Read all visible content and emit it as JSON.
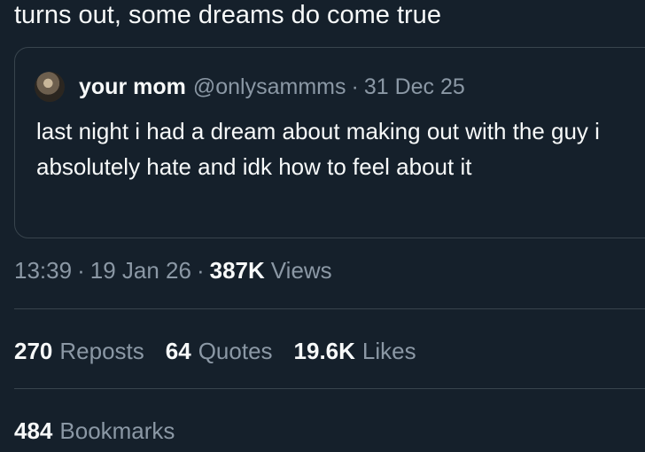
{
  "tweet": {
    "text": "turns out, some dreams do come true"
  },
  "quoted_tweet": {
    "display_name": "your mom",
    "handle": "@onlysammms",
    "separator": "·",
    "date": "31 Dec 25",
    "text": "last night i had a dream about making out with the guy i absolutely hate and idk how to feel about it",
    "avatar_icon": "user-avatar"
  },
  "meta": {
    "time": "13:39",
    "separator": "·",
    "date": "19 Jan 26",
    "views_count": "387K",
    "views_label": "Views"
  },
  "stats": {
    "reposts_count": "270",
    "reposts_label": "Reposts",
    "quotes_count": "64",
    "quotes_label": "Quotes",
    "likes_count": "19.6K",
    "likes_label": "Likes",
    "bookmarks_count": "484",
    "bookmarks_label": "Bookmarks"
  },
  "colors": {
    "background": "#15202b",
    "primary_text": "#f7f9f9",
    "secondary_text": "#8b98a5",
    "border": "#38444d"
  }
}
